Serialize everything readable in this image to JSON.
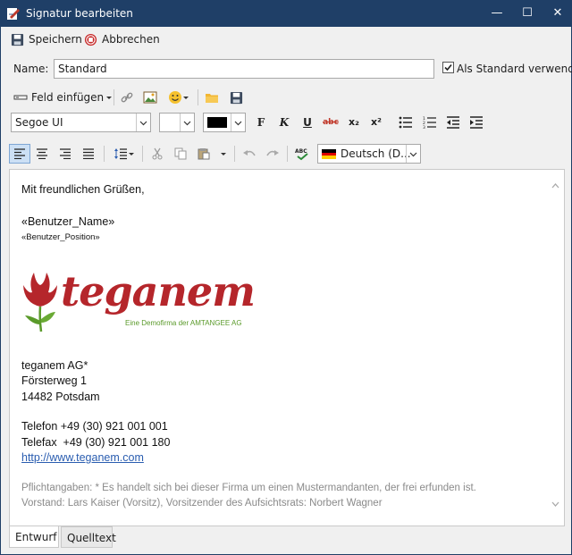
{
  "window": {
    "title": "Signatur bearbeiten"
  },
  "actions": {
    "save": "Speichern",
    "cancel": "Abbrechen"
  },
  "name_field": {
    "label": "Name:",
    "value": "Standard"
  },
  "default_checkbox": {
    "label": "Als Standard verwenden",
    "checked": true
  },
  "toolbar": {
    "insert_field": "Feld einfügen"
  },
  "format": {
    "font": "Segoe UI",
    "size": "",
    "bold": "F",
    "italic": "K",
    "underline": "U",
    "strike": "abc",
    "subscript": "x₂",
    "superscript": "x²"
  },
  "language": {
    "value": "Deutsch (D..."
  },
  "signature": {
    "greeting": "Mit freundlichen Grüßen,",
    "user_name": "«Benutzer_Name»",
    "user_position": "«Benutzer_Position»",
    "logo_text": "teganem",
    "logo_tagline": "Eine Demofirma der AMTANGEE AG",
    "company": "teganem AG*",
    "street": "Försterweg 1",
    "city": "14482 Potsdam",
    "phone": "Telefon +49 (30) 921 001 001",
    "fax": "Telefax  +49 (30) 921 001 180",
    "url": "http://www.teganem.com",
    "legal1": "Pflichtangaben: * Es handelt sich bei dieser Firma um einen Mustermandanten, der frei erfunden ist.",
    "legal2": "Vorstand: Lars Kaiser (Vorsitz), Vorsitzender des Aufsichtsrats: Norbert Wagner"
  },
  "tabs": {
    "design": "Entwurf",
    "source": "Quelltext"
  },
  "colors": {
    "titlebar": "#1f3f67",
    "brand_red": "#b5262b",
    "brand_green": "#5a9a2a",
    "link": "#2a5db0"
  }
}
